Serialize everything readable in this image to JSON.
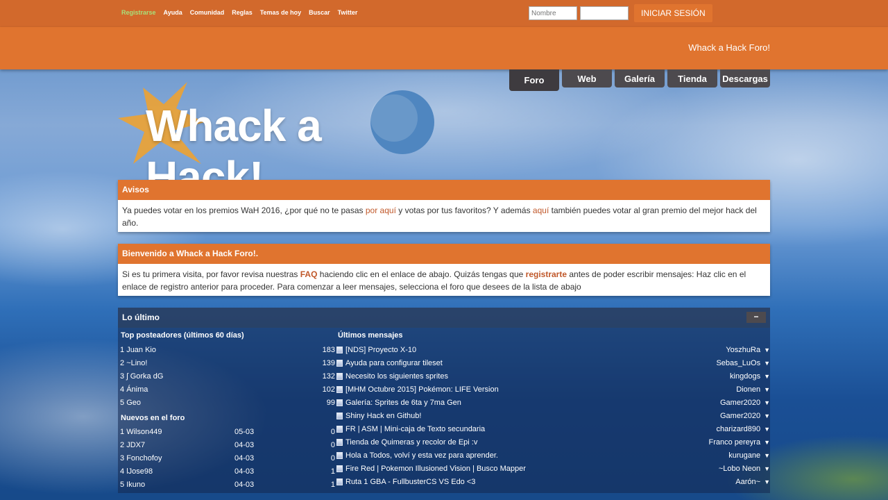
{
  "topbar": {
    "links": [
      "Registrarse",
      "Ayuda",
      "Comunidad",
      "Reglas",
      "Temas de hoy",
      "Buscar",
      "Twitter"
    ],
    "login": {
      "user_placeholder": "Nombre",
      "pass_placeholder": "",
      "button": "INICIAR SESIÓN"
    }
  },
  "header": {
    "site_title": "Whack a Hack Foro!"
  },
  "nav": {
    "tabs": [
      "Foro",
      "Web",
      "Galería",
      "Tienda",
      "Descargas"
    ]
  },
  "logo": {
    "text": "Whack a Hack!"
  },
  "avisos": {
    "title": "Avisos",
    "text_1": "Ya puedes votar en los premios WaH 2016, ¿por qué no te pasas ",
    "link_1": "por aquí",
    "text_2": " y votas por tus favoritos? Y además ",
    "link_2": "aquí",
    "text_3": " también puedes votar al gran premio del mejor hack del año."
  },
  "welcome": {
    "title": "Bienvenido a Whack a Hack Foro!.",
    "text_1": "Si es tu primera visita, por favor revisa nuestras ",
    "faq": "FAQ",
    "text_2": " haciendo clic en el enlace de abajo. Quizás tengas que ",
    "reg": "registrarte",
    "text_3": " antes de poder escribir mensajes: Haz clic en el enlace de registro anterior para proceder. Para comenzar a leer mensajes, selecciona el foro que desees de la lista de abajo"
  },
  "latest": {
    "title": "Lo último",
    "collapse": "−",
    "top_title": "Top posteadores (últimos 60 días)",
    "top": [
      {
        "rank": "1",
        "name": "Juan Kio",
        "count": "183"
      },
      {
        "rank": "2",
        "name": "~Lino!",
        "count": "139"
      },
      {
        "rank": "3",
        "name": "ʃ Gorka dG",
        "count": "132"
      },
      {
        "rank": "4",
        "name": "Ánima",
        "count": "102"
      },
      {
        "rank": "5",
        "name": "Geo",
        "count": "99"
      }
    ],
    "new_title": "Nuevos en el foro",
    "new": [
      {
        "rank": "1",
        "name": "Wilson449",
        "date": "05-03",
        "count": "0"
      },
      {
        "rank": "2",
        "name": "JDX7",
        "date": "04-03",
        "count": "0"
      },
      {
        "rank": "3",
        "name": "Fonchofoy",
        "date": "04-03",
        "count": "0"
      },
      {
        "rank": "4",
        "name": "lJose98",
        "date": "04-03",
        "count": "1"
      },
      {
        "rank": "5",
        "name": "Ikuno",
        "date": "04-03",
        "count": "1"
      }
    ],
    "posts_title": "Últimos mensajes",
    "posts": [
      {
        "title": "[NDS] Proyecto X-10",
        "user": "YoszhuRa"
      },
      {
        "title": "Ayuda para configurar tileset",
        "user": "Sebas_LuOs"
      },
      {
        "title": "Necesito los siguientes sprites",
        "user": "kingdogs"
      },
      {
        "title": "[MHM Octubre 2015] Pokémon: LIFE Version",
        "user": "Dionen"
      },
      {
        "title": "Galería: Sprites de 6ta y 7ma Gen",
        "user": "Gamer2020"
      },
      {
        "title": "Shiny Hack en Github!",
        "user": "Gamer2020"
      },
      {
        "title": "FR | ASM | Mini-caja de Texto secundaria",
        "user": "charizard890"
      },
      {
        "title": "Tienda de Quimeras y recolor de Epi :v",
        "user": "Franco pereyra"
      },
      {
        "title": "Hola a Todos, volví y esta vez para aprender.",
        "user": "kurugane"
      },
      {
        "title": "Fire Red | Pokemon Illusioned Vision | Busco Mapper",
        "user": "~Lobo Neon"
      },
      {
        "title": "Ruta 1 GBA - FullbusterCS VS Edo <3",
        "user": "Aarón~"
      }
    ]
  }
}
